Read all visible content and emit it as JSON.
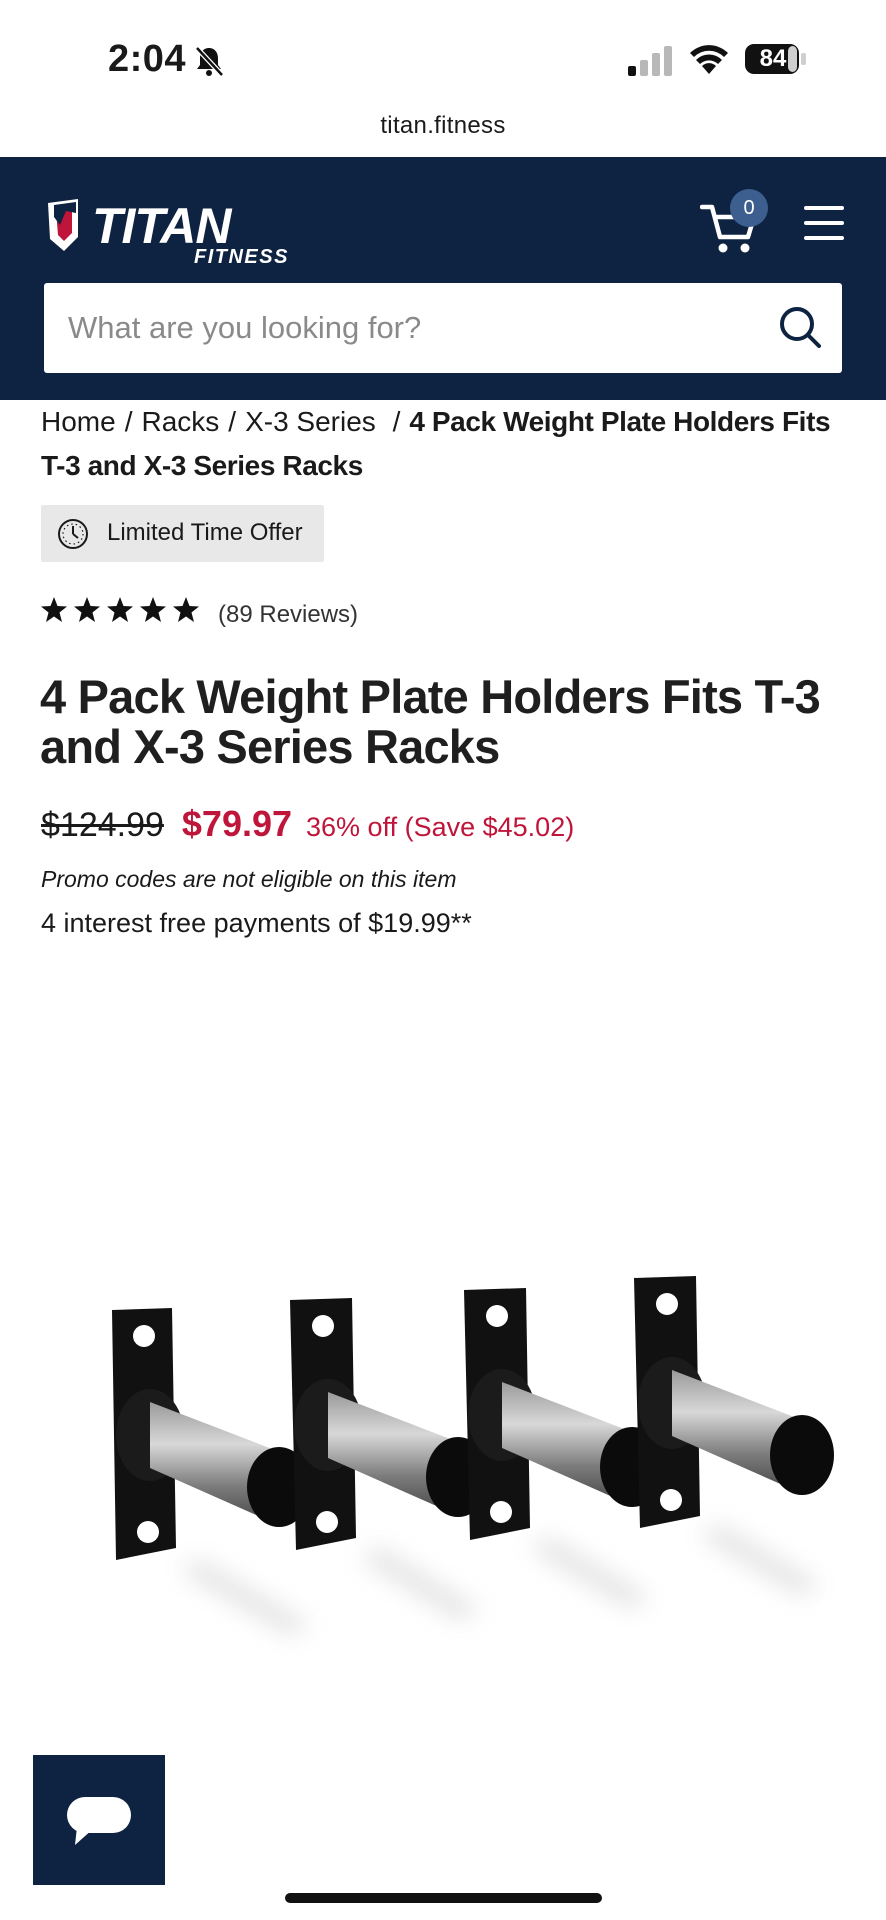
{
  "status_bar": {
    "time": "2:04",
    "battery": "84"
  },
  "browser": {
    "url": "titan.fitness"
  },
  "header": {
    "logo_text": "TITAN",
    "logo_subtext": "FITNESS",
    "cart_count": "0",
    "bg_color": "#0e2241"
  },
  "search": {
    "placeholder": "What are you looking for?"
  },
  "breadcrumb": {
    "items": [
      "Home",
      "Racks",
      "X-3 Series"
    ],
    "separator": "/",
    "current": "4 Pack Weight Plate Holders Fits T-3 and X-3 Series Racks"
  },
  "offer_badge": {
    "label": "Limited Time Offer"
  },
  "rating": {
    "stars": 5,
    "reviews_text": "(89 Reviews)"
  },
  "product": {
    "title": "4 Pack Weight Plate Holders Fits T-3 and X-3 Series Racks",
    "old_price": "$124.99",
    "new_price": "$79.97",
    "discount": "36% off (Save $45.02)",
    "promo_note": "Promo codes are not eligible on this item",
    "payments": "4 interest free payments of $19.99**",
    "sale_color": "#c0153a"
  }
}
